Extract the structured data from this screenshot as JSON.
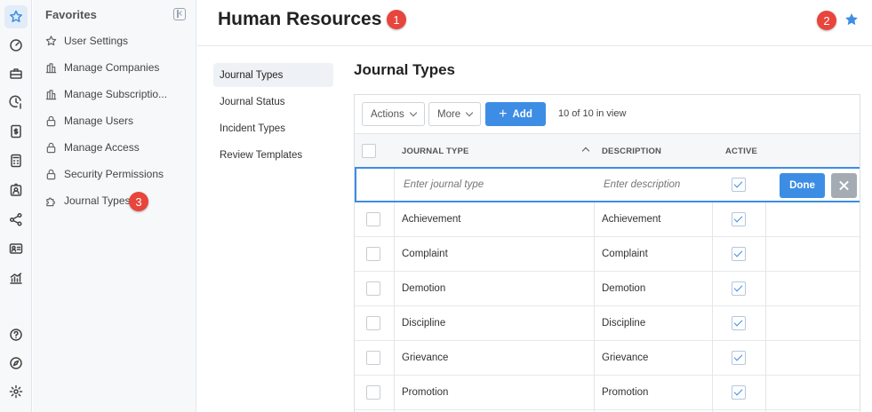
{
  "favorites": {
    "title": "Favorites",
    "items": [
      {
        "label": "User Settings",
        "icon": "star-outline-icon"
      },
      {
        "label": "Manage Companies",
        "icon": "building-icon"
      },
      {
        "label": "Manage Subscriptio...",
        "icon": "building-icon"
      },
      {
        "label": "Manage Users",
        "icon": "lock-icon"
      },
      {
        "label": "Manage Access",
        "icon": "lock-icon"
      },
      {
        "label": "Security Permissions",
        "icon": "lock-icon"
      },
      {
        "label": "Journal Types",
        "icon": "puzzle-icon"
      }
    ]
  },
  "header": {
    "title": "Human Resources"
  },
  "badges": {
    "one": "1",
    "two": "2",
    "three": "3"
  },
  "subnav": [
    {
      "label": "Journal Types",
      "active": true
    },
    {
      "label": "Journal Status",
      "active": false
    },
    {
      "label": "Incident Types",
      "active": false
    },
    {
      "label": "Review Templates",
      "active": false
    }
  ],
  "section": {
    "title": "Journal Types"
  },
  "toolbar": {
    "actions_label": "Actions",
    "more_label": "More",
    "add_label": "Add",
    "count_label": "10 of 10 in view"
  },
  "table": {
    "columns": [
      "JOURNAL TYPE",
      "DESCRIPTION",
      "ACTIVE"
    ],
    "edit_row": {
      "journal_type_placeholder": "Enter journal type",
      "description_placeholder": "Enter description",
      "done_label": "Done"
    },
    "rows": [
      {
        "type": "Achievement",
        "description": "Achievement",
        "active": true
      },
      {
        "type": "Complaint",
        "description": "Complaint",
        "active": true
      },
      {
        "type": "Demotion",
        "description": "Demotion",
        "active": true
      },
      {
        "type": "Discipline",
        "description": "Discipline",
        "active": true
      },
      {
        "type": "Grievance",
        "description": "Grievance",
        "active": true
      },
      {
        "type": "Promotion",
        "description": "Promotion",
        "active": true
      }
    ]
  },
  "colors": {
    "accent": "#3d8de5",
    "badge": "#e8453c"
  }
}
